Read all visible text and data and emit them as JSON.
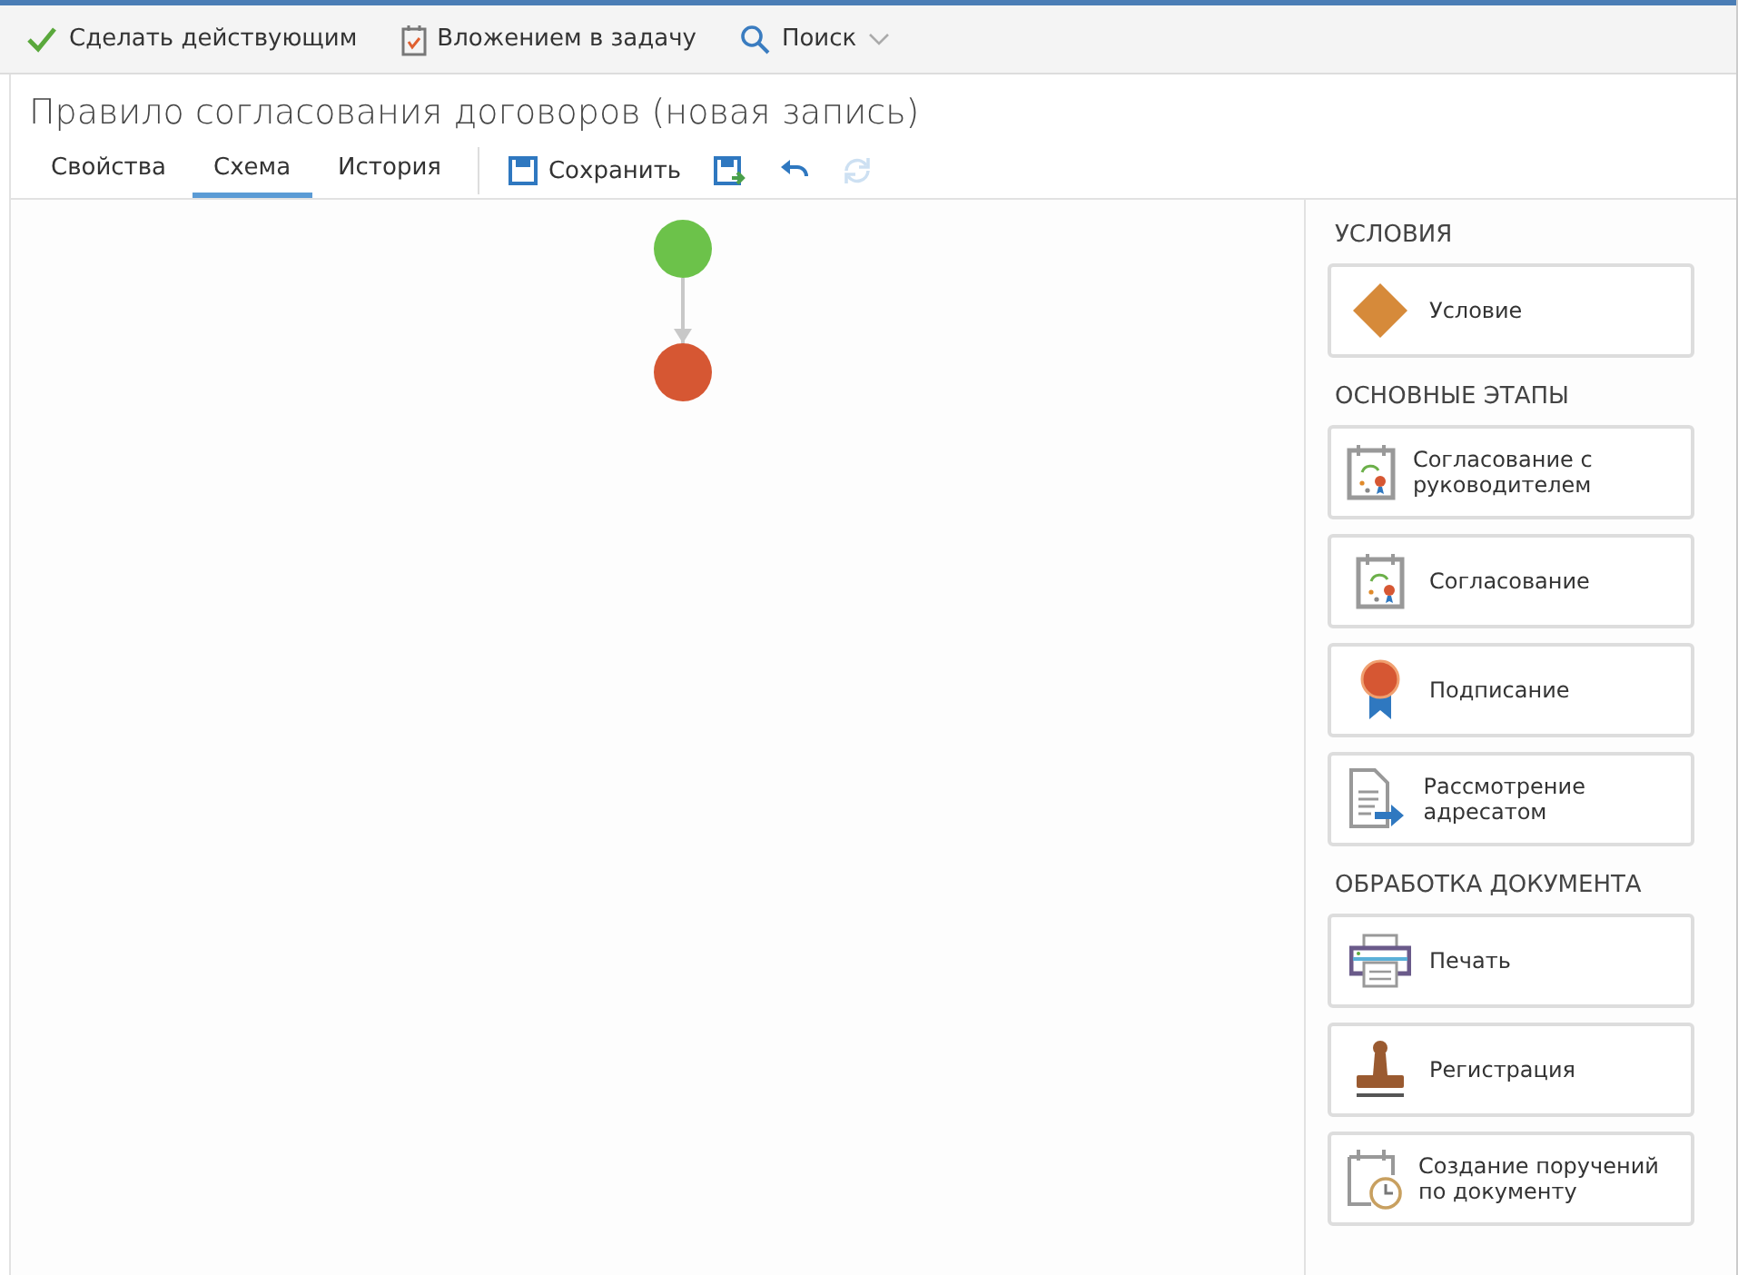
{
  "toolbar": [
    {
      "kind": "check",
      "label": "Сделать действующим"
    },
    {
      "kind": "calendar",
      "label": "Вложением в задачу"
    },
    {
      "kind": "search",
      "label": "Поиск",
      "dropdown": true
    }
  ],
  "title": "Правило согласования договоров (новая запись)",
  "tabs": [
    {
      "label": "Свойства",
      "selected": false
    },
    {
      "label": "Схема",
      "selected": true
    },
    {
      "label": "История",
      "selected": false
    }
  ],
  "actions": [
    {
      "kind": "save",
      "label": "Сохранить",
      "disabled": false
    },
    {
      "kind": "save-as",
      "disabled": false
    },
    {
      "kind": "undo",
      "disabled": false
    },
    {
      "kind": "refresh",
      "disabled": true
    }
  ],
  "diagram": {
    "nodes": [
      {
        "color": "#6cc24a"
      },
      {
        "color": "#d65733"
      }
    ]
  },
  "palette": [
    {
      "title": "УСЛОВИЯ",
      "items": [
        {
          "kind": "condition",
          "label": "Условие"
        }
      ]
    },
    {
      "title": "ОСНОВНЫЕ ЭТАПЫ",
      "items": [
        {
          "kind": "approval",
          "label": "Согласование с руководителем"
        },
        {
          "kind": "approval",
          "label": "Согласование"
        },
        {
          "kind": "signing",
          "label": "Подписание"
        },
        {
          "kind": "review",
          "label": "Рассмотрение адресатом"
        }
      ]
    },
    {
      "title": "ОБРАБОТКА ДОКУМЕНТА",
      "items": [
        {
          "kind": "print",
          "label": "Печать"
        },
        {
          "kind": "stamp",
          "label": "Регистрация"
        },
        {
          "kind": "tasks",
          "label": "Создание поручений по документу"
        }
      ]
    }
  ]
}
